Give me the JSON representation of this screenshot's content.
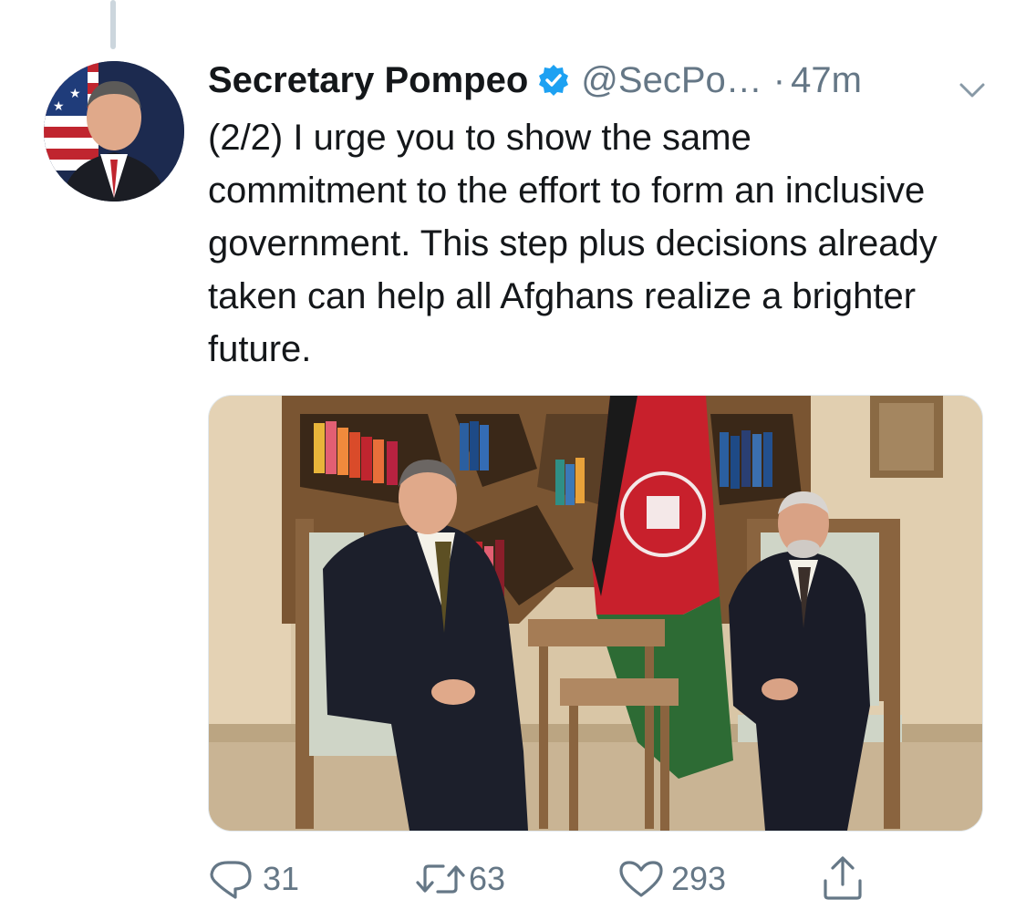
{
  "tweet": {
    "author_name": "Secretary Pompeo",
    "handle": "@SecPo…",
    "separator": "·",
    "time": "47m",
    "text": "(2/2) I urge you to show the same commitment to the effort to form an inclusive government. This step plus decisions already taken can help all Afghans realize a brighter future.",
    "verified": true
  },
  "icons": {
    "verified": "verified-badge-icon",
    "caret": "chevron-down-icon",
    "reply": "reply-icon",
    "retweet": "retweet-icon",
    "like": "heart-icon",
    "share": "share-icon"
  },
  "actions": {
    "reply_count": "31",
    "retweet_count": "63",
    "like_count": "293"
  },
  "colors": {
    "text": "#14171a",
    "secondary": "#657786",
    "verified": "#1da1f2",
    "divider": "#ccd6dd"
  }
}
